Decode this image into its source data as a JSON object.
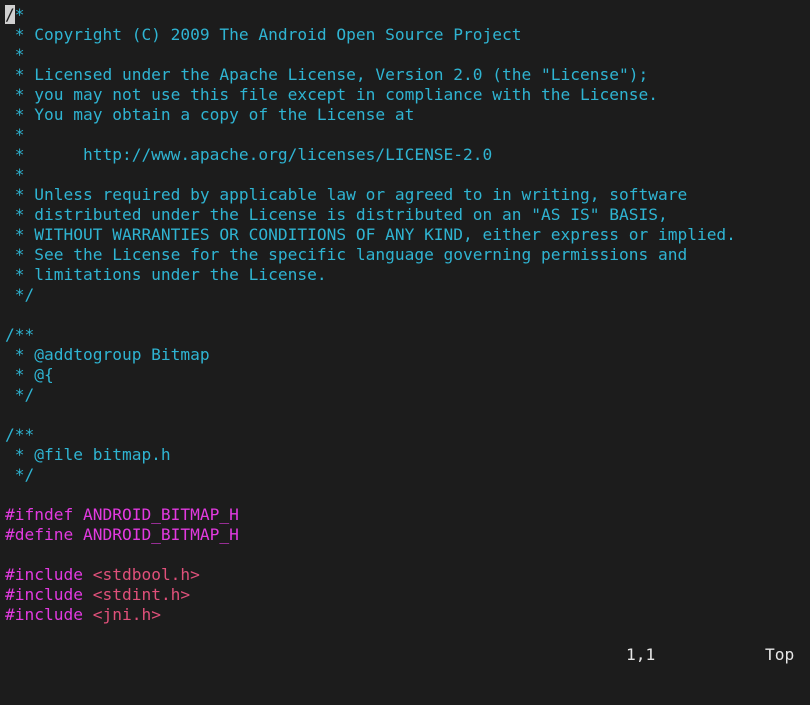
{
  "editor": {
    "cursor_char": "/",
    "lines": [
      {
        "kind": "comment",
        "text": "*"
      },
      {
        "kind": "comment",
        "text": " * Copyright (C) 2009 The Android Open Source Project"
      },
      {
        "kind": "comment",
        "text": " *"
      },
      {
        "kind": "comment",
        "text": " * Licensed under the Apache License, Version 2.0 (the \"License\");"
      },
      {
        "kind": "comment",
        "text": " * you may not use this file except in compliance with the License."
      },
      {
        "kind": "comment",
        "text": " * You may obtain a copy of the License at"
      },
      {
        "kind": "comment",
        "text": " *"
      },
      {
        "kind": "comment",
        "text": " *      http://www.apache.org/licenses/LICENSE-2.0"
      },
      {
        "kind": "comment",
        "text": " *"
      },
      {
        "kind": "comment",
        "text": " * Unless required by applicable law or agreed to in writing, software"
      },
      {
        "kind": "comment",
        "text": " * distributed under the License is distributed on an \"AS IS\" BASIS,"
      },
      {
        "kind": "comment",
        "text": " * WITHOUT WARRANTIES OR CONDITIONS OF ANY KIND, either express or implied."
      },
      {
        "kind": "comment",
        "text": " * See the License for the specific language governing permissions and"
      },
      {
        "kind": "comment",
        "text": " * limitations under the License."
      },
      {
        "kind": "comment",
        "text": " */"
      },
      {
        "kind": "blank",
        "text": ""
      },
      {
        "kind": "comment",
        "text": "/**"
      },
      {
        "kind": "comment",
        "text": " * @addtogroup Bitmap"
      },
      {
        "kind": "comment",
        "text": " * @{"
      },
      {
        "kind": "comment",
        "text": " */"
      },
      {
        "kind": "blank",
        "text": ""
      },
      {
        "kind": "comment",
        "text": "/**"
      },
      {
        "kind": "comment",
        "text": " * @file bitmap.h"
      },
      {
        "kind": "comment",
        "text": " */"
      },
      {
        "kind": "blank",
        "text": ""
      },
      {
        "kind": "preproc",
        "text": "#ifndef ANDROID_BITMAP_H"
      },
      {
        "kind": "preproc",
        "text": "#define ANDROID_BITMAP_H"
      },
      {
        "kind": "blank",
        "text": ""
      },
      {
        "kind": "include",
        "directive": "#include ",
        "path": "<stdbool.h>"
      },
      {
        "kind": "include",
        "directive": "#include ",
        "path": "<stdint.h>"
      },
      {
        "kind": "include",
        "directive": "#include ",
        "path": "<jni.h>"
      }
    ]
  },
  "statusline": {
    "position": "1,1",
    "scroll": "Top"
  }
}
